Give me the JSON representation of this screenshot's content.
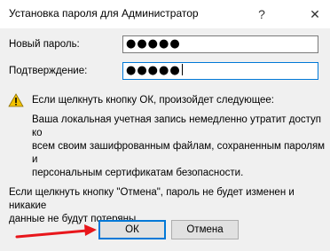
{
  "dialog": {
    "title": "Установка пароля для Администратор",
    "help_glyph": "?",
    "close_glyph": "✕"
  },
  "form": {
    "new_password_label": "Новый пароль:",
    "new_password_value": "●●●●●",
    "confirm_label": "Подтверждение:",
    "confirm_value": "●●●●●"
  },
  "warning": {
    "icon": "warning-triangle-icon",
    "heading": "Если щелкнуть кнопку ОК, произойдет следующее:",
    "body_lines": [
      "Ваша локальная учетная запись немедленно утратит доступ ко",
      "всем своим зашифрованным файлам, сохраненным паролям и",
      "персональным сертификатам безопасности."
    ]
  },
  "cancel_note": {
    "lines": [
      "Если щелкнуть кнопку \"Отмена\", пароль не будет изменен и никакие",
      "данные не будут потеряны."
    ]
  },
  "buttons": {
    "ok_label": "ОК",
    "cancel_label": "Отмена"
  },
  "colors": {
    "focus_accent": "#0078d7",
    "annotation_arrow": "#e8161b"
  }
}
